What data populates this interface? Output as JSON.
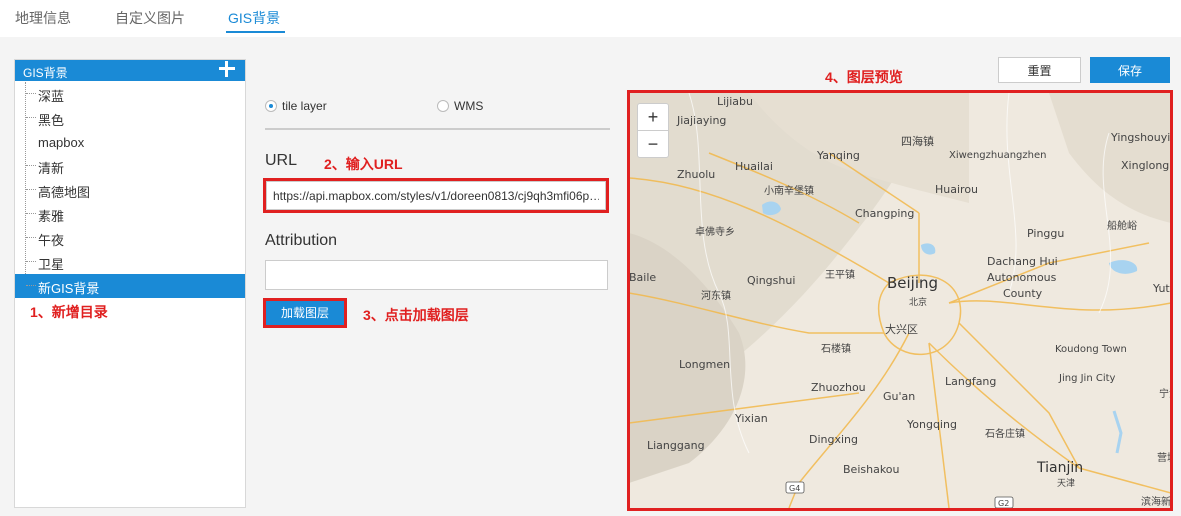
{
  "tabs": [
    "地理信息",
    "自定义图片",
    "GIS背景"
  ],
  "tree": {
    "title": "GIS背景",
    "items": [
      "深蓝",
      "黑色",
      "mapbox",
      "清新",
      "高德地图",
      "素雅",
      "午夜",
      "卫星",
      "新GIS背景"
    ],
    "selected_index": 8
  },
  "annotations": {
    "step1": "1、新增目录",
    "step2": "2、输入URL",
    "step3": "3、点击加载图层",
    "step4": "4、图层预览"
  },
  "form": {
    "radio_tile": "tile layer",
    "radio_wms": "WMS",
    "selected": "tile layer",
    "url_label": "URL",
    "url_value": "https://api.mapbox.com/styles/v1/doreen0813/cj9qh3mfi06p…",
    "attribution_label": "Attribution",
    "attribution_value": "",
    "load_button": "加载图层"
  },
  "actions": {
    "reset": "重置",
    "save": "保存"
  },
  "map": {
    "zoom_in": "+",
    "zoom_out": "−",
    "labels": {
      "lijiabu": "Lijiabu",
      "jiajiaying": "Jiajiaying",
      "sihaizhen": "四海镇",
      "yingshouyin": "Yingshouyin",
      "yanqing": "Yanqing",
      "huailai": "Huailai",
      "xiwengzhuang": "Xiwengzhuangzhen",
      "xinglong": "Xinglong",
      "zhuolu": "Zhuolu",
      "xiaonanxinbao": "小南辛堡镇",
      "huairou": "Huairou",
      "changping": "Changping",
      "chuanlingyu": "船舱峪",
      "pinggu": "Pinggu",
      "zhuofosi": "卓佛寺乡",
      "dachanghui": "Dachang Hui",
      "autonomous": "Autonomous",
      "county": "County",
      "baile": "Baile",
      "qingshui": "Qingshui",
      "wangping": "王平镇",
      "beijing": "Beijing",
      "beijing_cn": "北京",
      "hedong": "河东镇",
      "yutia": "Yutia",
      "daxing": "大兴区",
      "shilou": "石楼镇",
      "kougong": "Koudong Town",
      "longmen": "Longmen",
      "jingjin": "Jing Jin City",
      "zhuozhou": "Zhuozhou",
      "langfang": "Langfang",
      "ning": "宁河",
      "guan": "Gu'an",
      "yixian": "Yixian",
      "yongqing": "Yongqing",
      "shigezhuang": "石各庄镇",
      "dingxing": "Dingxing",
      "lianggang": "Lianggang",
      "tianjin": "Tianjin",
      "tianjin_cn": "天津",
      "beishakou": "Beishakou",
      "yingcheng": "营城",
      "binhai": "滨海新",
      "g4": "G4",
      "g2": "G2"
    }
  },
  "colors": {
    "accent": "#1a8ad6",
    "annotation_red": "#e02020"
  }
}
